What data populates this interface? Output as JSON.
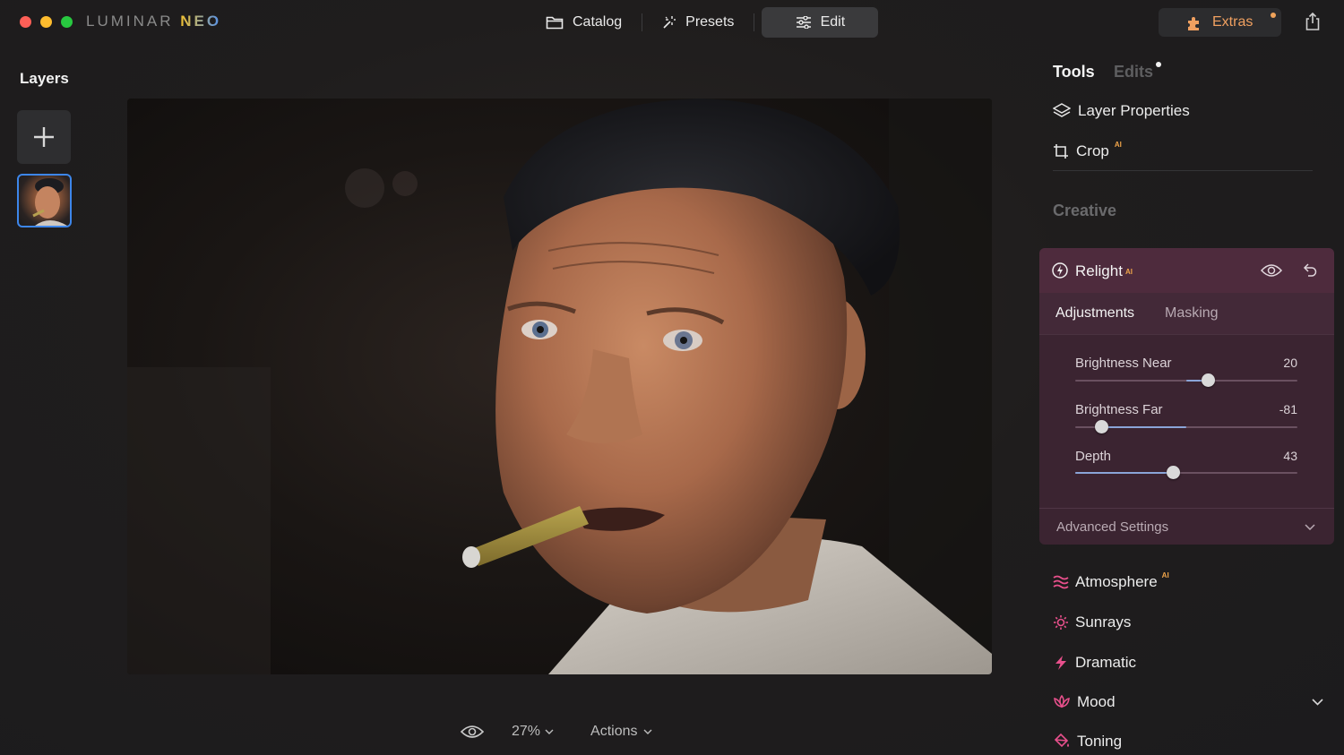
{
  "app": {
    "logo_text": "LUMINAR",
    "logo_accent": "NEO",
    "colors": {
      "close": "#fe5f57",
      "minimize": "#febc2e",
      "zoom": "#28c840",
      "accent_blue": "#3d86ea",
      "ai_badge": "#f0a54a",
      "relight_bg": "#4e2b3d",
      "tool_icon_pink": "#e8508c"
    }
  },
  "nav": {
    "catalog": "Catalog",
    "presets": "Presets",
    "edit": "Edit",
    "active": "edit"
  },
  "extras": {
    "label": "Extras"
  },
  "layers": {
    "title": "Layers"
  },
  "bottom": {
    "zoom": "27%",
    "actions": "Actions"
  },
  "panel": {
    "tab_tools": "Tools",
    "tab_edits": "Edits",
    "layer_properties": "Layer Properties",
    "crop": "Crop",
    "ai_badge": "AI",
    "section_creative": "Creative",
    "relight": {
      "title": "Relight",
      "tab_adjustments": "Adjustments",
      "tab_masking": "Masking",
      "sliders": [
        {
          "label": "Brightness Near",
          "value": "20",
          "min": -100,
          "max": 100,
          "numeric": 20
        },
        {
          "label": "Brightness Far",
          "value": "-81",
          "min": -100,
          "max": 100,
          "numeric": -81
        },
        {
          "label": "Depth",
          "value": "43",
          "min": 0,
          "max": 100,
          "numeric": 43
        }
      ],
      "advanced": "Advanced Settings"
    },
    "tools": [
      {
        "label": "Atmosphere",
        "ai": true,
        "icon": "waves-icon"
      },
      {
        "label": "Sunrays",
        "ai": false,
        "icon": "sun-icon"
      },
      {
        "label": "Dramatic",
        "ai": false,
        "icon": "lightning-icon"
      },
      {
        "label": "Mood",
        "ai": false,
        "icon": "lotus-icon"
      },
      {
        "label": "Toning",
        "ai": false,
        "icon": "paint-bucket-icon"
      }
    ]
  }
}
